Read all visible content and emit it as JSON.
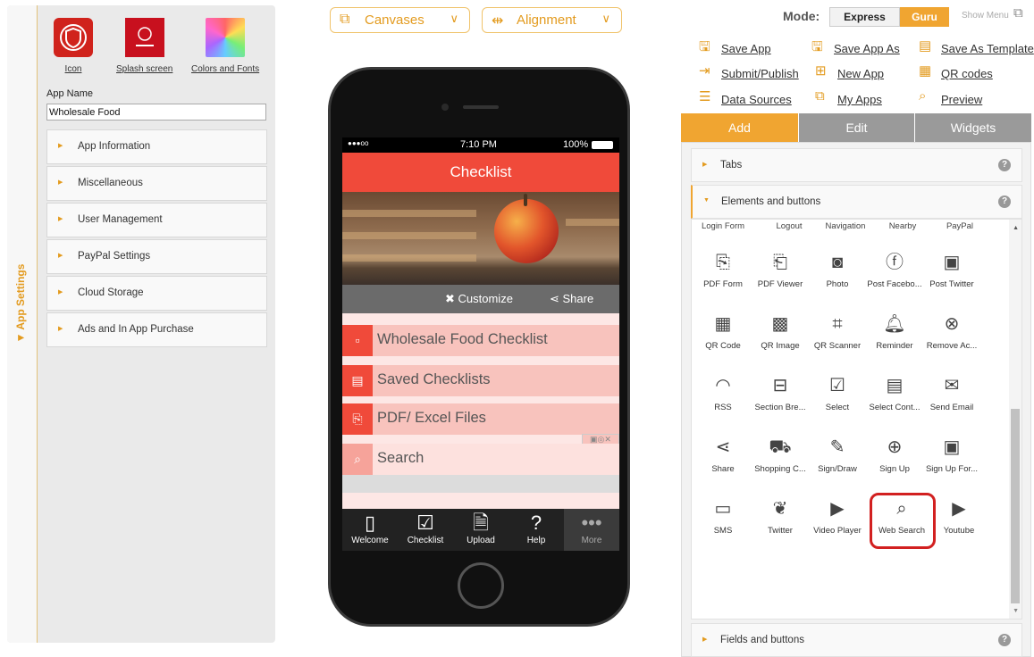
{
  "left_panel": {
    "vertical_tab": "App Settings",
    "top_icons": [
      {
        "label": "Icon",
        "color": "#d0231c"
      },
      {
        "label": "Splash screen",
        "color": "#c8101e"
      },
      {
        "label": "Colors and Fonts",
        "color": "#7fd6b2"
      }
    ],
    "app_name_label": "App Name",
    "app_name_value": "Wholesale Food",
    "sections": [
      "App Information",
      "Miscellaneous",
      "User Management",
      "PayPal Settings",
      "Cloud Storage",
      "Ads and In App Purchase"
    ]
  },
  "toolbar": {
    "canvases": "Canvases",
    "alignment": "Alignment"
  },
  "phone": {
    "status": {
      "signal": "●●●oo",
      "time": "7:10 PM",
      "battery": "100%"
    },
    "title": "Checklist",
    "customize": "Customize",
    "share": "Share",
    "menu_items": [
      {
        "label": "Wholesale Food Checklist",
        "icon": "document-icon"
      },
      {
        "label": "Saved Checklists",
        "icon": "list-icon"
      },
      {
        "label": "PDF/ Excel Files",
        "icon": "file-icon"
      },
      {
        "label": "Search",
        "icon": "search-icon"
      }
    ],
    "tabbar": [
      {
        "label": "Welcome",
        "icon": "phone-icon"
      },
      {
        "label": "Checklist",
        "icon": "checklist-icon"
      },
      {
        "label": "Upload",
        "icon": "pdf-icon"
      },
      {
        "label": "Help",
        "icon": "help-icon"
      },
      {
        "label": "More",
        "icon": "more-icon"
      }
    ]
  },
  "mode": {
    "label": "Mode:",
    "express": "Express",
    "guru": "Guru",
    "show_menu": "Show Menu"
  },
  "top_links": [
    {
      "label": "Save App",
      "icon": "save-icon"
    },
    {
      "label": "Save App As",
      "icon": "save-as-icon"
    },
    {
      "label": "Save As Template",
      "icon": "template-icon"
    },
    {
      "label": "Submit/Publish",
      "icon": "publish-icon"
    },
    {
      "label": "New App",
      "icon": "plus-icon"
    },
    {
      "label": "QR codes",
      "icon": "qr-icon"
    },
    {
      "label": "Data Sources",
      "icon": "database-icon"
    },
    {
      "label": "My Apps",
      "icon": "apps-icon"
    },
    {
      "label": "Preview",
      "icon": "preview-icon"
    }
  ],
  "tabs": {
    "add": "Add",
    "edit": "Edit",
    "widgets": "Widgets"
  },
  "sections": {
    "tabs": "Tabs",
    "elements": "Elements and buttons",
    "fields": "Fields and buttons",
    "help": "?"
  },
  "truncated_row": [
    "Login Form",
    "Logout",
    "Navigation",
    "Nearby",
    "PayPal"
  ],
  "widgets": [
    {
      "label": "PDF Form",
      "icon": "pdf-form-icon"
    },
    {
      "label": "PDF Viewer",
      "icon": "pdf-viewer-icon"
    },
    {
      "label": "Photo",
      "icon": "camera-icon"
    },
    {
      "label": "Post Facebo...",
      "icon": "facebook-icon"
    },
    {
      "label": "Post Twitter",
      "icon": "twitter-post-icon"
    },
    {
      "label": "QR Code",
      "icon": "qr-code-icon"
    },
    {
      "label": "QR Image",
      "icon": "qr-image-icon"
    },
    {
      "label": "QR Scanner",
      "icon": "qr-scanner-icon"
    },
    {
      "label": "Reminder",
      "icon": "bell-icon"
    },
    {
      "label": "Remove Ac...",
      "icon": "remove-account-icon"
    },
    {
      "label": "RSS",
      "icon": "rss-icon"
    },
    {
      "label": "Section Bre...",
      "icon": "section-break-icon"
    },
    {
      "label": "Select",
      "icon": "checkbox-icon"
    },
    {
      "label": "Select Cont...",
      "icon": "select-contact-icon"
    },
    {
      "label": "Send Email",
      "icon": "email-icon"
    },
    {
      "label": "Share",
      "icon": "share-icon"
    },
    {
      "label": "Shopping C...",
      "icon": "cart-icon"
    },
    {
      "label": "Sign/Draw",
      "icon": "pen-icon"
    },
    {
      "label": "Sign Up",
      "icon": "sign-up-icon"
    },
    {
      "label": "Sign Up For...",
      "icon": "sign-up-form-icon"
    },
    {
      "label": "SMS",
      "icon": "sms-icon"
    },
    {
      "label": "Twitter",
      "icon": "twitter-icon"
    },
    {
      "label": "Video Player",
      "icon": "video-player-icon"
    },
    {
      "label": "Web Search",
      "icon": "web-search-icon"
    },
    {
      "label": "Youtube",
      "icon": "youtube-icon"
    }
  ],
  "colors": {
    "accent": "#f0a531",
    "header": "#f04a3a",
    "highlight": "#d22020"
  }
}
